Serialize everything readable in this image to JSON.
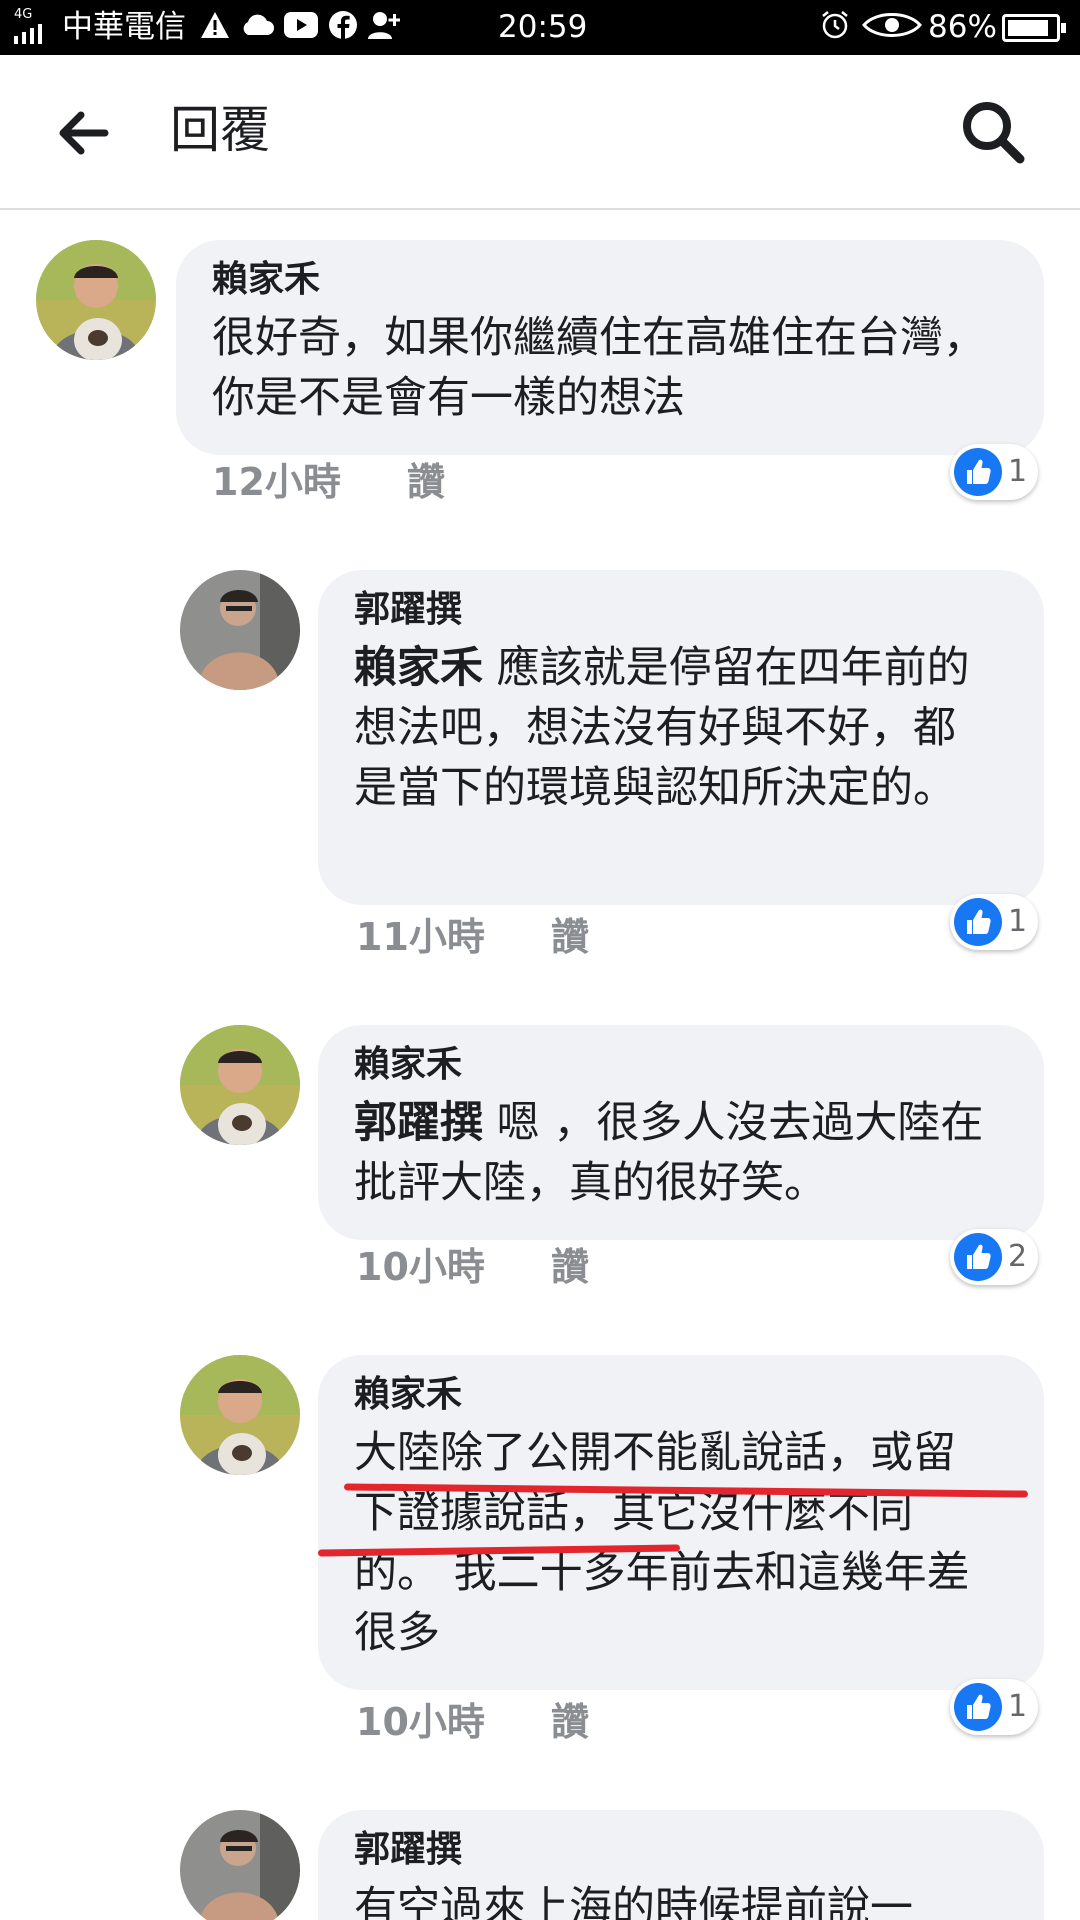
{
  "status_bar": {
    "network": "4G",
    "carrier": "中華電信",
    "time": "20:59",
    "battery": "86%",
    "battery_level": 0.86
  },
  "header": {
    "title": "回覆",
    "back_icon": "arrow-left-icon",
    "search_icon": "search-icon"
  },
  "like_label": "讚",
  "colors": {
    "bubble": "#f0f2f5",
    "like_blue": "#1877f2",
    "meta_gray": "#8a8d91",
    "underline_red": "#e3262d"
  },
  "comments": [
    {
      "author": "賴家禾",
      "mention": "",
      "text": "很好奇，如果你繼續住在高雄住在台灣，你是不是會有一樣的想法",
      "time": "12小時",
      "likes": "1"
    },
    {
      "author": "郭躍撰",
      "mention": "賴家禾",
      "text": " 應該就是停留在四年前的想法吧，想法沒有好與不好，都是當下的環境與認知所決定的。",
      "time": "11小時",
      "likes": "1"
    },
    {
      "author": "賴家禾",
      "mention": "郭躍撰",
      "text": " 嗯 ，很多人沒去過大陸在批評大陸，真的很好笑。",
      "time": "10小時",
      "likes": "2"
    },
    {
      "author": "賴家禾",
      "mention": "",
      "text": "大陸除了公開不能亂說話，或留下證據說話，其它沒什麼不同的。 我二十多年前去和這幾年差很多",
      "time": "10小時",
      "likes": "1"
    },
    {
      "author": "郭躍撰",
      "mention": "",
      "text": " 有空過來上海的時候提前說一",
      "time": "",
      "likes": ""
    }
  ]
}
